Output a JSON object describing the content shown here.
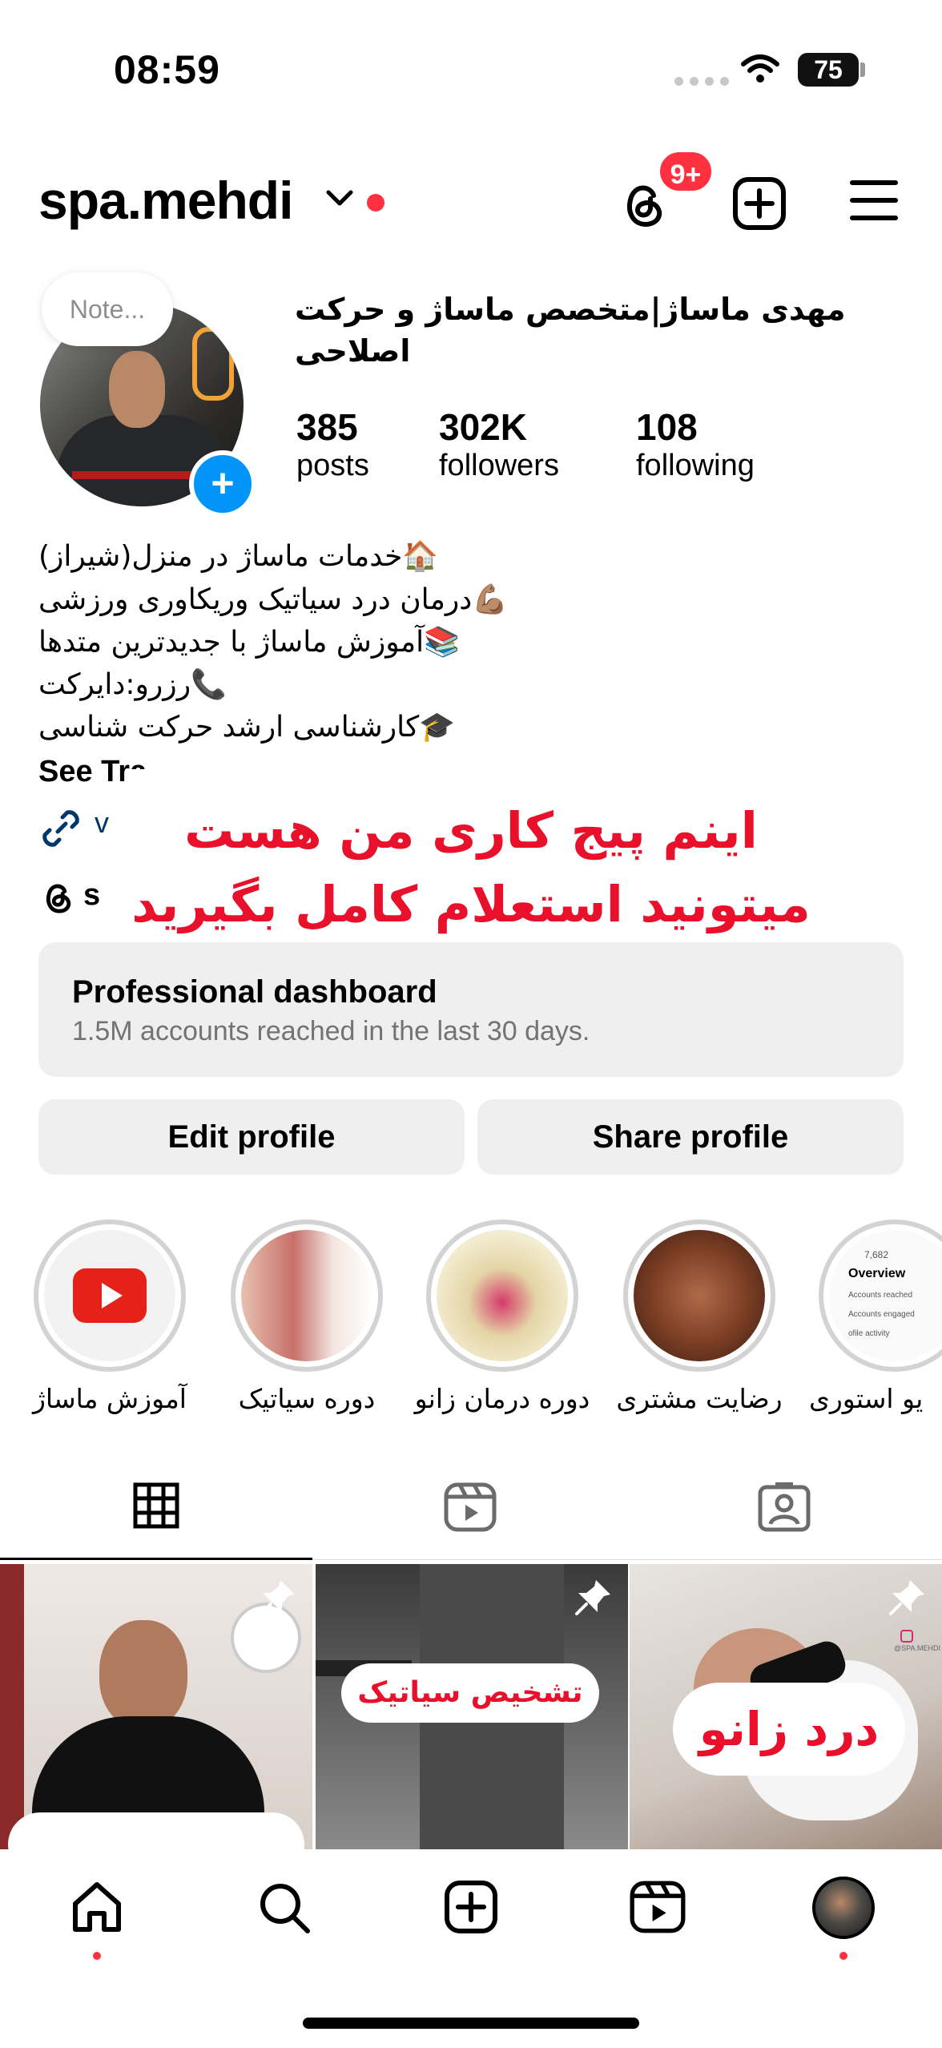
{
  "status_bar": {
    "time": "08:59",
    "battery": "75"
  },
  "header": {
    "username": "spa.mehdi",
    "notifications_badge": "9+"
  },
  "profile": {
    "note_placeholder": "Note...",
    "full_name": "مهدی ماساژ|متخصص ماساژ و حرکت اصلاحی",
    "stats": [
      {
        "value": "385",
        "label": "posts"
      },
      {
        "value": "302K",
        "label": "followers"
      },
      {
        "value": "108",
        "label": "following"
      }
    ],
    "bio_lines": [
      "🏠خدمات ماساژ در منزل(شیراز)",
      "💪🏽درمان درد سیاتیک وریکاوری ورزشی",
      "📚آموزش ماساژ با جدیدترین متدها",
      "📞رزرو:دایرکت",
      "🎓کارشناسی ارشد حرکت شناسی"
    ],
    "see_translation": "See Tra",
    "link_partial": "v",
    "threads_partial": "s"
  },
  "overlay_text": {
    "line1": "اینم پیج کاری من هست",
    "line2": "میتونید استعلام کامل بگیرید"
  },
  "dashboard": {
    "title": "Professional dashboard",
    "subtitle": "1.5M accounts reached in the last 30 days."
  },
  "buttons": {
    "edit": "Edit profile",
    "share": "Share profile"
  },
  "highlights": [
    {
      "label": "آموزش ماساژ"
    },
    {
      "label": "دوره سیاتیک"
    },
    {
      "label": "دوره درمان زانو"
    },
    {
      "label": "رضایت مشتری"
    },
    {
      "label": "یو استوری"
    }
  ],
  "highlight_overview": {
    "title": "Overview",
    "count": "7,682",
    "row1": "Accounts reached",
    "row2": "Accounts engaged",
    "row3": "ofile activity"
  },
  "posts": [
    {
      "caption": ""
    },
    {
      "caption": "تشخیص سیاتیک"
    },
    {
      "caption": "درد زانو",
      "handle": "@SPA.MEHDI"
    }
  ],
  "colors": {
    "accent": "#0095f6",
    "notification": "#ff3040",
    "overlay_text": "#e8102a"
  }
}
